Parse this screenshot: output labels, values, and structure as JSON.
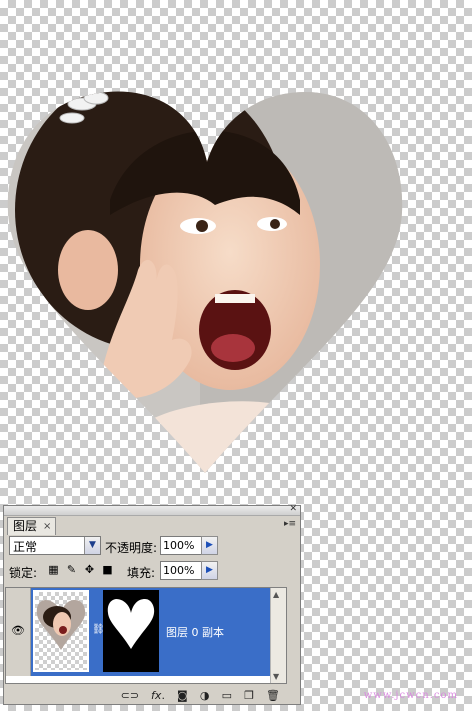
{
  "panel": {
    "tab_label": "图层",
    "tab_close": "×",
    "blend_mode": "正常",
    "opacity_label": "不透明度:",
    "opacity_value": "100%",
    "lock_label": "锁定:",
    "fill_label": "填充:",
    "fill_value": "100%"
  },
  "layers": [
    {
      "name": "图层 0 副本",
      "visible": true,
      "selected": true
    }
  ],
  "watermark": "www.jcwcn.com",
  "colors": {
    "selected_row": "#3a6ec8",
    "panel_bg": "#d4d0c8"
  },
  "icons": [
    "eye-icon",
    "link-icon",
    "fx-icon",
    "mask-icon",
    "adjustment-icon",
    "folder-icon",
    "new-layer-icon",
    "trash-icon"
  ]
}
